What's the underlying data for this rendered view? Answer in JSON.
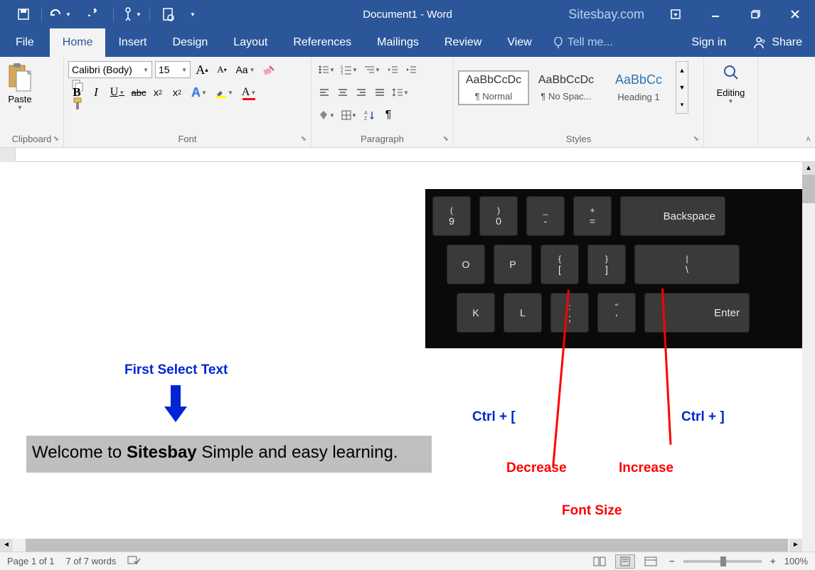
{
  "titlebar": {
    "document_title": "Document1 - Word",
    "brand": "Sitesbay.com"
  },
  "tabs": {
    "file": "File",
    "home": "Home",
    "insert": "Insert",
    "design": "Design",
    "layout": "Layout",
    "references": "References",
    "mailings": "Mailings",
    "review": "Review",
    "view": "View",
    "tellme": "Tell me...",
    "signin": "Sign in",
    "share": "Share"
  },
  "ribbon": {
    "clipboard": {
      "label": "Clipboard",
      "paste": "Paste"
    },
    "font": {
      "label": "Font",
      "name": "Calibri (Body)",
      "size": "15",
      "grow": "A",
      "shrink": "A",
      "case": "Aa",
      "bold": "B",
      "italic": "I",
      "underline": "U",
      "strike": "abc",
      "sub": "x",
      "sub2": "2",
      "sup": "x",
      "sup2": "2",
      "texteffects": "A",
      "highlight": "",
      "color": "A"
    },
    "paragraph": {
      "label": "Paragraph"
    },
    "styles": {
      "label": "Styles",
      "items": [
        {
          "preview": "AaBbCcDc",
          "name": "¶ Normal"
        },
        {
          "preview": "AaBbCcDc",
          "name": "¶ No Spac..."
        },
        {
          "preview": "AaBbCc",
          "name": "Heading 1"
        }
      ]
    },
    "editing": {
      "label": "Editing"
    }
  },
  "document": {
    "annotation_select": "First Select Text",
    "selected_text_pre": "Welcome to ",
    "selected_text_bold": "Sitesbay",
    "selected_text_post": " Simple and easy learning.",
    "shortcut_decrease": "Ctrl + [",
    "shortcut_increase": "Ctrl + ]",
    "action_decrease": "Decrease",
    "action_increase": "Increase",
    "action_fontsize": "Font Size"
  },
  "keyboard": {
    "row1": [
      {
        "top": "(",
        "bot": "9"
      },
      {
        "top": ")",
        "bot": "0"
      },
      {
        "top": "_",
        "bot": "-"
      },
      {
        "top": "+",
        "bot": "="
      },
      {
        "label": "Backspace",
        "wide": true
      }
    ],
    "row2": [
      {
        "bot": "O"
      },
      {
        "bot": "P"
      },
      {
        "top": "{",
        "bot": "["
      },
      {
        "top": "}",
        "bot": "]"
      },
      {
        "top": "|",
        "bot": "\\",
        "wide": true
      }
    ],
    "row3": [
      {
        "bot": "K"
      },
      {
        "bot": "L"
      },
      {
        "top": ":",
        "bot": ";"
      },
      {
        "top": "\"",
        "bot": "'"
      },
      {
        "label": "Enter",
        "wide": true
      }
    ]
  },
  "statusbar": {
    "page": "Page 1 of 1",
    "words": "7 of 7 words",
    "zoom": "100%"
  }
}
